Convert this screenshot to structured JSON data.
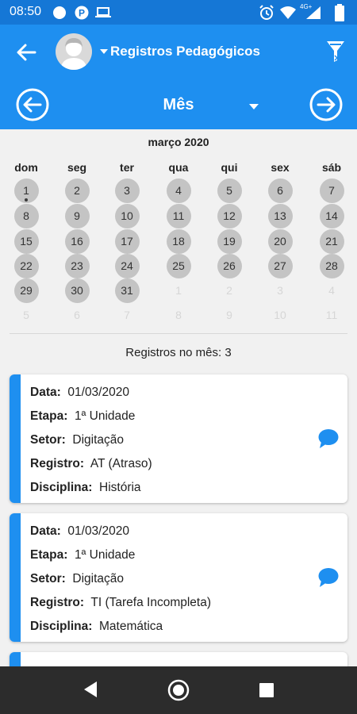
{
  "status_bar": {
    "time": "08:50",
    "right_icons": [
      "alarm-icon",
      "wifi-icon",
      "signal-icon",
      "battery-icon"
    ],
    "network_label": "4G+"
  },
  "app_bar": {
    "title": "Registros Pedagógicos"
  },
  "month_nav": {
    "label": "Mês"
  },
  "calendar": {
    "title": "março 2020",
    "weekdays": [
      "dom",
      "seg",
      "ter",
      "qua",
      "qui",
      "sex",
      "sáb"
    ],
    "weeks": [
      [
        {
          "d": "1",
          "in": true,
          "dot": true
        },
        {
          "d": "2",
          "in": true
        },
        {
          "d": "3",
          "in": true
        },
        {
          "d": "4",
          "in": true
        },
        {
          "d": "5",
          "in": true
        },
        {
          "d": "6",
          "in": true
        },
        {
          "d": "7",
          "in": true
        }
      ],
      [
        {
          "d": "8",
          "in": true
        },
        {
          "d": "9",
          "in": true
        },
        {
          "d": "10",
          "in": true
        },
        {
          "d": "11",
          "in": true
        },
        {
          "d": "12",
          "in": true
        },
        {
          "d": "13",
          "in": true
        },
        {
          "d": "14",
          "in": true
        }
      ],
      [
        {
          "d": "15",
          "in": true
        },
        {
          "d": "16",
          "in": true
        },
        {
          "d": "17",
          "in": true
        },
        {
          "d": "18",
          "in": true
        },
        {
          "d": "19",
          "in": true
        },
        {
          "d": "20",
          "in": true
        },
        {
          "d": "21",
          "in": true
        }
      ],
      [
        {
          "d": "22",
          "in": true
        },
        {
          "d": "23",
          "in": true
        },
        {
          "d": "24",
          "in": true
        },
        {
          "d": "25",
          "in": true
        },
        {
          "d": "26",
          "in": true
        },
        {
          "d": "27",
          "in": true
        },
        {
          "d": "28",
          "in": true
        }
      ],
      [
        {
          "d": "29",
          "in": true
        },
        {
          "d": "30",
          "in": true
        },
        {
          "d": "31",
          "in": true
        },
        {
          "d": "1",
          "in": false
        },
        {
          "d": "2",
          "in": false
        },
        {
          "d": "3",
          "in": false
        },
        {
          "d": "4",
          "in": false
        }
      ],
      [
        {
          "d": "5",
          "in": false
        },
        {
          "d": "6",
          "in": false
        },
        {
          "d": "7",
          "in": false
        },
        {
          "d": "8",
          "in": false
        },
        {
          "d": "9",
          "in": false
        },
        {
          "d": "10",
          "in": false
        },
        {
          "d": "11",
          "in": false
        }
      ]
    ]
  },
  "summary": {
    "text": "Registros no mês: 3"
  },
  "records": [
    {
      "fields": [
        {
          "label": "Data:",
          "value": "01/03/2020"
        },
        {
          "label": "Etapa:",
          "value": "1ª Unidade"
        },
        {
          "label": "Setor:",
          "value": "Digitação"
        },
        {
          "label": "Registro:",
          "value": "AT (Atraso)"
        },
        {
          "label": "Disciplina:",
          "value": "História"
        }
      ]
    },
    {
      "fields": [
        {
          "label": "Data:",
          "value": "01/03/2020"
        },
        {
          "label": "Etapa:",
          "value": "1ª Unidade"
        },
        {
          "label": "Setor:",
          "value": "Digitação"
        },
        {
          "label": "Registro:",
          "value": "TI (Tarefa Incompleta)"
        },
        {
          "label": "Disciplina:",
          "value": "Matemática"
        }
      ]
    }
  ],
  "colors": {
    "primary": "#1e8ff0",
    "status_bar": "#1577d6",
    "day_circle": "#c4c4c4",
    "nav_bar": "#2c2c2c"
  }
}
